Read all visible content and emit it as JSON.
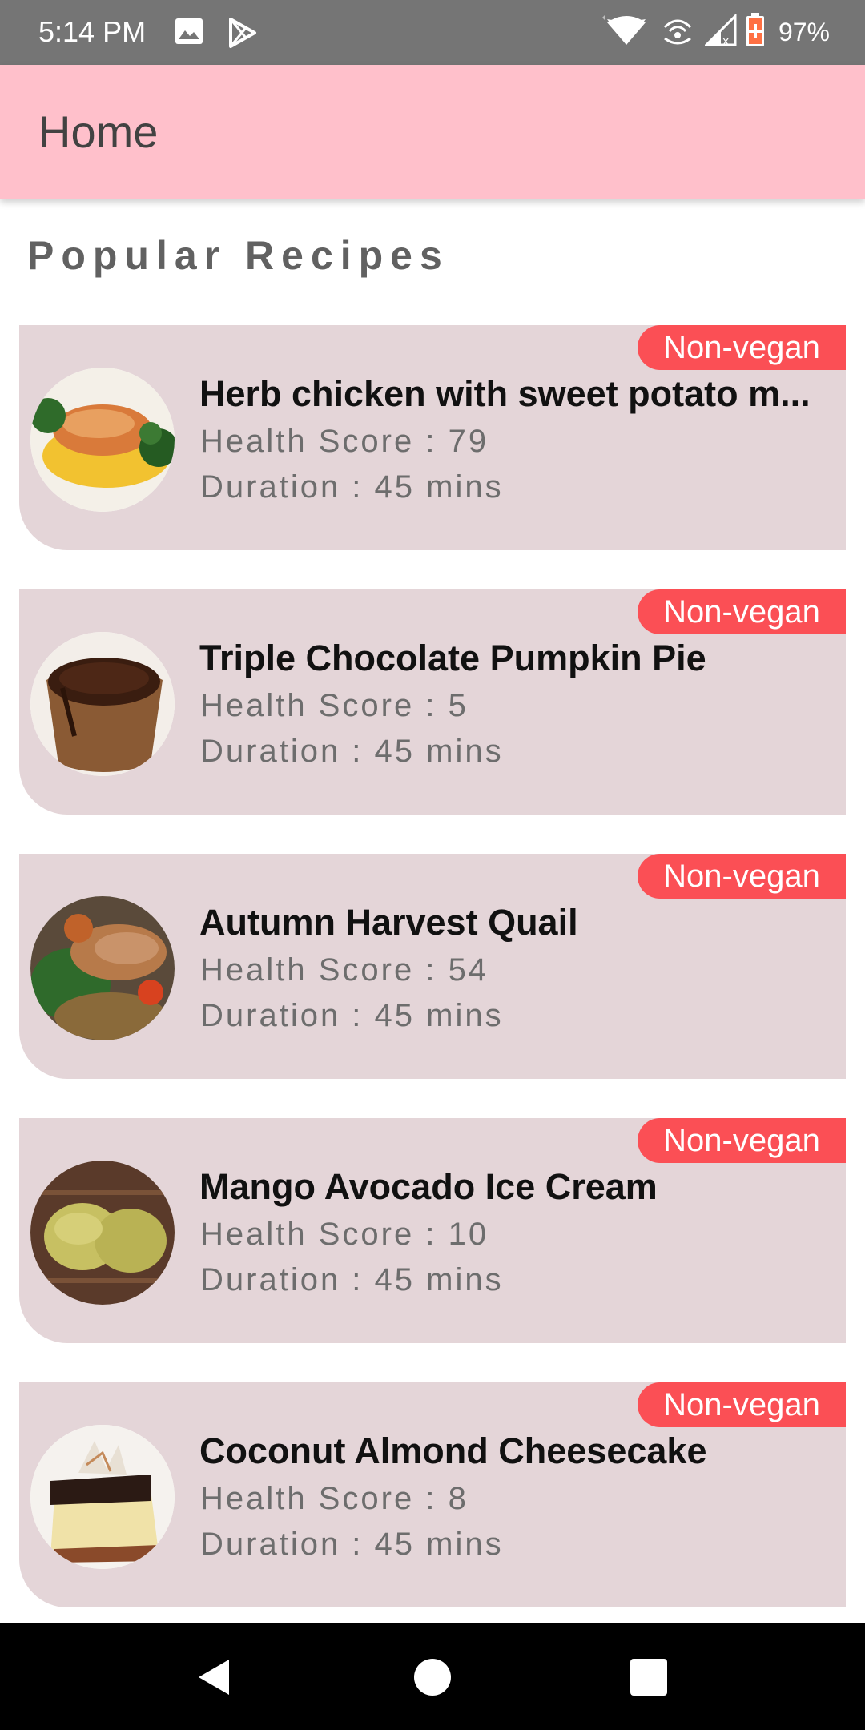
{
  "status_bar": {
    "time": "5:14 PM",
    "battery": "97%",
    "icons": [
      "image-icon",
      "play-store-icon",
      "wifi-icon",
      "hotspot-icon",
      "signal-icon",
      "battery-icon"
    ]
  },
  "app_bar": {
    "title": "Home",
    "background": "#ffc0cb"
  },
  "section": {
    "heading": "Popular Recipes"
  },
  "recipes": [
    {
      "title": "Herb chicken with sweet potato m...",
      "badge": "Non-vegan",
      "health_score": "Health Score : 79",
      "duration": "Duration : 45 mins",
      "image": "herb-chicken-photo"
    },
    {
      "title": "Triple Chocolate Pumpkin Pie",
      "badge": "Non-vegan",
      "health_score": "Health Score : 5",
      "duration": "Duration : 45 mins",
      "image": "chocolate-pumpkin-pie-photo"
    },
    {
      "title": "Autumn Harvest Quail",
      "badge": "Non-vegan",
      "health_score": "Health Score : 54",
      "duration": "Duration : 45 mins",
      "image": "quail-photo"
    },
    {
      "title": "Mango Avocado Ice Cream",
      "badge": "Non-vegan",
      "health_score": "Health Score : 10",
      "duration": "Duration : 45 mins",
      "image": "ice-cream-photo"
    },
    {
      "title": "Coconut Almond Cheesecake",
      "badge": "Non-vegan",
      "health_score": "Health Score : 8",
      "duration": "Duration : 45 mins",
      "image": "cheesecake-photo"
    }
  ],
  "colors": {
    "card_background": "#e4d5d8",
    "badge": "#fb4f55",
    "status_bar": "#757575"
  },
  "nav_bar": {
    "buttons": [
      "back-icon",
      "home-icon",
      "recents-icon"
    ]
  }
}
